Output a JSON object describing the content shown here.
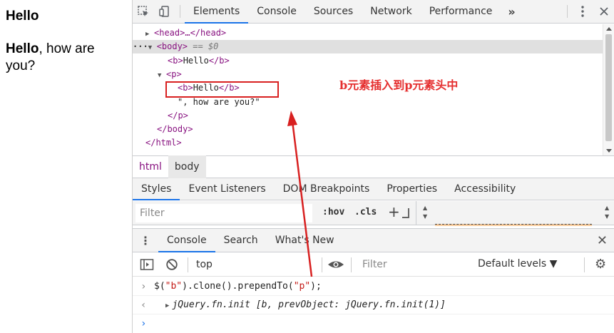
{
  "page": {
    "heading": "Hello",
    "para_bold": "Hello",
    "para_rest": ", how are you?"
  },
  "devtools": {
    "tabs": [
      "Elements",
      "Console",
      "Sources",
      "Network",
      "Performance"
    ],
    "more": "»",
    "tree": {
      "head": "<head>…</head>",
      "body_open": "<body>",
      "body_eq": " == $0",
      "b1_open": "<b>",
      "b1_text": "Hello",
      "b1_close": "</b>",
      "p_open": "<p>",
      "b2_open": "<b>",
      "b2_text": "Hello",
      "b2_close": "</b>",
      "p_text": "\", how are you?\"",
      "p_close": "</p>",
      "body_close": "</body>",
      "html_close": "</html>"
    },
    "annotation": "b元素插入到p元素头中",
    "breadcrumbs": [
      "html",
      "body"
    ],
    "style_tabs": [
      "Styles",
      "Event Listeners",
      "DOM Breakpoints",
      "Properties",
      "Accessibility"
    ],
    "styles_filter_placeholder": "Filter",
    "hov": ":hov",
    "cls": ".cls",
    "drawer_tabs": [
      "Console",
      "Search",
      "What's New"
    ],
    "console_context": "top",
    "console_filter_placeholder": "Filter",
    "console_levels": "Default levels ▼",
    "console": {
      "cmd_pre": "$(",
      "cmd_str1": "\"b\"",
      "cmd_mid": ").clone().prependTo(",
      "cmd_str2": "\"p\"",
      "cmd_post": ");",
      "result": "jQuery.fn.init [b, prevObject: jQuery.fn.init(1)]"
    }
  },
  "colors": {
    "accent": "#1a73e8",
    "tag": "#881280",
    "annotation": "#e53030",
    "highlight": "#d82020"
  }
}
